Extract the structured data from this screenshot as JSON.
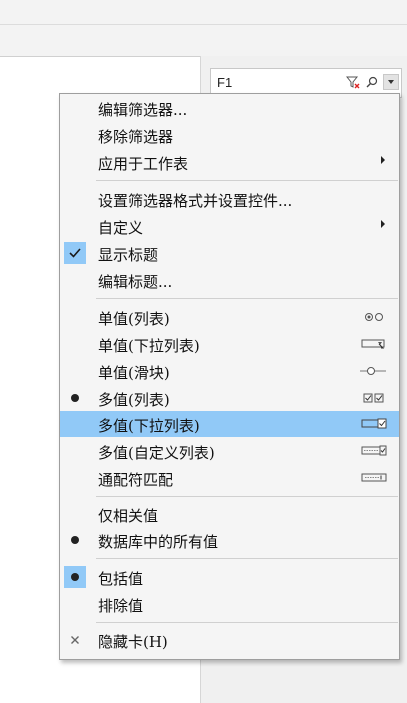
{
  "filter_card": {
    "title": "F1"
  },
  "menu": {
    "items": [
      {
        "label": "编辑筛选器..."
      },
      {
        "label": "移除筛选器"
      },
      {
        "label": "应用于工作表"
      },
      {
        "label": "设置筛选器格式并设置控件..."
      },
      {
        "label": "自定义"
      },
      {
        "label": "显示标题"
      },
      {
        "label": "编辑标题..."
      },
      {
        "label": "单值(列表)"
      },
      {
        "label": "单值(下拉列表)"
      },
      {
        "label": "单值(滑块)"
      },
      {
        "label": "多值(列表)"
      },
      {
        "label": "多值(下拉列表)"
      },
      {
        "label": "多值(自定义列表)"
      },
      {
        "label": "通配符匹配"
      },
      {
        "label": "仅相关值"
      },
      {
        "label": "数据库中的所有值"
      },
      {
        "label": "包括值"
      },
      {
        "label": "排除值"
      },
      {
        "label": "隐藏卡(H)"
      }
    ]
  },
  "colors": {
    "highlight": "#91c9f7",
    "menu_bg": "#f5f5f5"
  }
}
